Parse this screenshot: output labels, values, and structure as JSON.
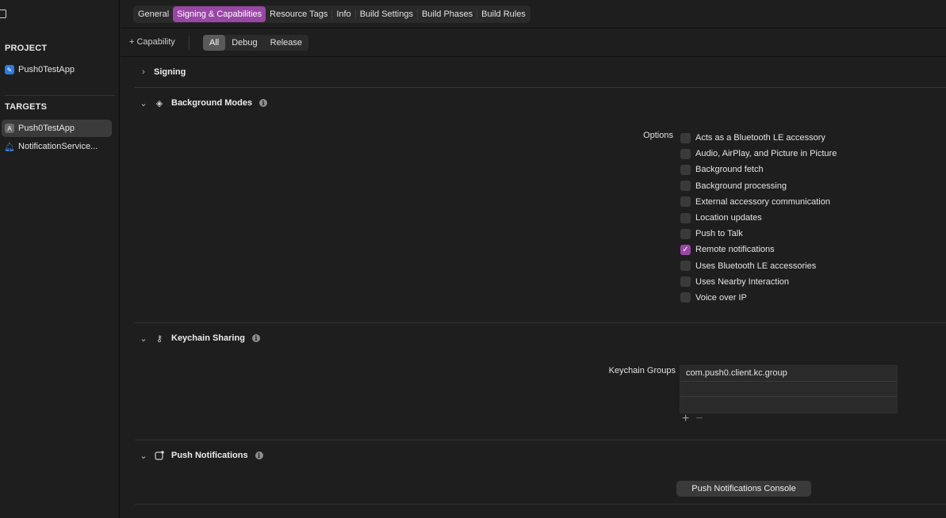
{
  "sidebar": {
    "project_header": "PROJECT",
    "project_item": "Push0TestApp",
    "targets_header": "TARGETS",
    "targets": [
      {
        "label": "Push0TestApp",
        "icon": "app-target-icon",
        "selected": true
      },
      {
        "label": "NotificationService...",
        "icon": "bell-extension-icon",
        "selected": false
      }
    ]
  },
  "tabs": [
    "General",
    "Signing & Capabilities",
    "Resource Tags",
    "Info",
    "Build Settings",
    "Build Phases",
    "Build Rules"
  ],
  "active_tab": "Signing & Capabilities",
  "capbar": {
    "add_capability": "+ Capability",
    "filters": [
      "All",
      "Debug",
      "Release"
    ],
    "active_filter": "All"
  },
  "sections": {
    "signing": {
      "title": "Signing"
    },
    "background_modes": {
      "title": "Background Modes",
      "options_label": "Options",
      "options": [
        {
          "label": "Acts as a Bluetooth LE accessory",
          "checked": false
        },
        {
          "label": "Audio, AirPlay, and Picture in Picture",
          "checked": false
        },
        {
          "label": "Background fetch",
          "checked": false
        },
        {
          "label": "Background processing",
          "checked": false
        },
        {
          "label": "External accessory communication",
          "checked": false
        },
        {
          "label": "Location updates",
          "checked": false
        },
        {
          "label": "Push to Talk",
          "checked": false
        },
        {
          "label": "Remote notifications",
          "checked": true
        },
        {
          "label": "Uses Bluetooth LE accessories",
          "checked": false
        },
        {
          "label": "Uses Nearby Interaction",
          "checked": false
        },
        {
          "label": "Voice over IP",
          "checked": false
        }
      ]
    },
    "keychain_sharing": {
      "title": "Keychain Sharing",
      "groups_label": "Keychain Groups",
      "groups": [
        "com.push0.client.kc.group",
        "",
        ""
      ],
      "add_symbol": "+",
      "remove_symbol": "−"
    },
    "push_notifications": {
      "title": "Push Notifications",
      "console_button": "Push Notifications Console"
    }
  },
  "colors": {
    "accent": "#9a46a6",
    "background": "#1e1e1e"
  }
}
